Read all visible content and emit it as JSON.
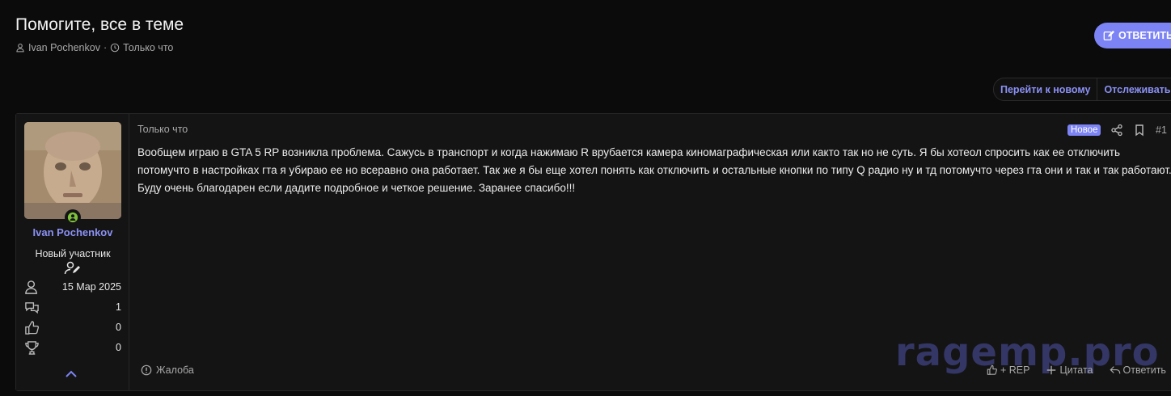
{
  "thread": {
    "title": "Помогите, все в теме",
    "author": "Ivan Pochenkov",
    "separator": "·",
    "time": "Только что",
    "reply_button": "ОТВЕТИТЬ"
  },
  "toolbar": {
    "goto_new": "Перейти к новому",
    "watch": "Отслеживать"
  },
  "post": {
    "date": "Только что",
    "new_badge": "Новое",
    "number": "#1",
    "body": "Вообщем играю в GTA 5 RP возникла проблема. Сажусь в транспорт и когда нажимаю R врубается камера киномаграфическая или както так но не суть. Я бы хотеол спросить как ее отключить потомучто в настройках гта я убираю ее но всеравно она работает. Так же я бы еще хотел понять как отключить и остальные кнопки по типу Q радио ну и тд потомучто через гта они и так и так работают. Буду очень благодарен если дадите подробное и четкое решение. Заранее спасибо!!!",
    "report": "Жалоба",
    "rep": "+ REP",
    "quote": "Цитата",
    "reply": "Ответить"
  },
  "user": {
    "name": "Ivan Pochenkov",
    "title": "Новый участник",
    "joined": "15 Мар 2025",
    "messages": "1",
    "reactions": "0",
    "points": "0"
  },
  "watermark": "ragemp.pro",
  "colors": {
    "accent": "#7c83f4",
    "link": "#8b91f5",
    "online": "#7ec23a"
  }
}
